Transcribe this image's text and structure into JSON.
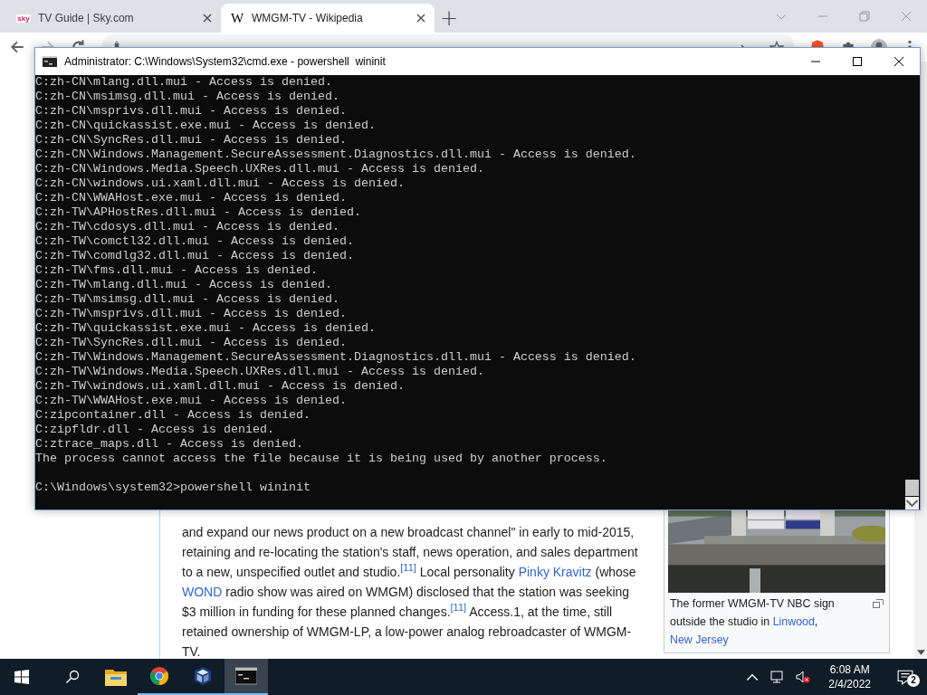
{
  "browser": {
    "tabs": [
      {
        "title": "TV Guide | Sky.com",
        "favicon": "sky",
        "kind": "sky",
        "selected": false
      },
      {
        "title": "WMGM-TV - Wikipedia",
        "favicon": "W",
        "kind": "wiki",
        "selected": true
      }
    ],
    "new_tab": "+"
  },
  "article": {
    "paragraph": [
      {
        "text": "and expand our news product on a new broadcast channel\" in early to mid-2015, retaining and re-locating the station's staff, news operation, and sales department to a new, unspecified outlet and studio.",
        "kind": "text"
      },
      {
        "text": "[11]",
        "kind": "ref"
      },
      {
        "text": " Local personality ",
        "kind": "text"
      },
      {
        "text": "Pinky Kravitz",
        "kind": "link"
      },
      {
        "text": " (whose ",
        "kind": "text"
      },
      {
        "text": "WOND",
        "kind": "link"
      },
      {
        "text": " radio show was aired on WMGM) disclosed that the station was seeking $3 million in funding for these planned changes.",
        "kind": "text"
      },
      {
        "text": "[11]",
        "kind": "ref"
      },
      {
        "text": " Access.1, at the time, still retained ownership of WMGM-LP, a low-power analog rebroadcaster of WMGM-TV.",
        "kind": "text"
      }
    ],
    "figure": {
      "caption": [
        {
          "text": "The former WMGM-TV NBC sign outside the studio in ",
          "kind": "text"
        },
        {
          "text": "Linwood",
          "kind": "link"
        },
        {
          "text": ", ",
          "kind": "text"
        },
        {
          "text": "New Jersey",
          "kind": "link"
        }
      ]
    }
  },
  "console_window": {
    "title": "Administrator: C:\\Windows\\System32\\cmd.exe - powershell  wininit",
    "lines": [
      "C:zh-CN\\mlang.dll.mui - Access is denied.",
      "C:zh-CN\\msimsg.dll.mui - Access is denied.",
      "C:zh-CN\\msprivs.dll.mui - Access is denied.",
      "C:zh-CN\\quickassist.exe.mui - Access is denied.",
      "C:zh-CN\\SyncRes.dll.mui - Access is denied.",
      "C:zh-CN\\Windows.Management.SecureAssessment.Diagnostics.dll.mui - Access is denied.",
      "C:zh-CN\\Windows.Media.Speech.UXRes.dll.mui - Access is denied.",
      "C:zh-CN\\windows.ui.xaml.dll.mui - Access is denied.",
      "C:zh-CN\\WWAHost.exe.mui - Access is denied.",
      "C:zh-TW\\APHostRes.dll.mui - Access is denied.",
      "C:zh-TW\\cdosys.dll.mui - Access is denied.",
      "C:zh-TW\\comctl32.dll.mui - Access is denied.",
      "C:zh-TW\\comdlg32.dll.mui - Access is denied.",
      "C:zh-TW\\fms.dll.mui - Access is denied.",
      "C:zh-TW\\mlang.dll.mui - Access is denied.",
      "C:zh-TW\\msimsg.dll.mui - Access is denied.",
      "C:zh-TW\\msprivs.dll.mui - Access is denied.",
      "C:zh-TW\\quickassist.exe.mui - Access is denied.",
      "C:zh-TW\\SyncRes.dll.mui - Access is denied.",
      "C:zh-TW\\Windows.Management.SecureAssessment.Diagnostics.dll.mui - Access is denied.",
      "C:zh-TW\\Windows.Media.Speech.UXRes.dll.mui - Access is denied.",
      "C:zh-TW\\windows.ui.xaml.dll.mui - Access is denied.",
      "C:zh-TW\\WWAHost.exe.mui - Access is denied.",
      "C:zipcontainer.dll - Access is denied.",
      "C:zipfldr.dll - Access is denied.",
      "C:ztrace_maps.dll - Access is denied.",
      "The process cannot access the file because it is being used by another process."
    ],
    "prompt": "C:\\Windows\\system32>powershell wininit"
  },
  "taskbar": {
    "apps": [
      {
        "kind": "explorer",
        "running": false,
        "selected": false
      },
      {
        "kind": "chrome",
        "running": true,
        "selected": false
      },
      {
        "kind": "virtualbox",
        "running": true,
        "selected": false
      },
      {
        "kind": "terminal",
        "running": true,
        "selected": true
      }
    ],
    "clock": {
      "time": "6:08 AM",
      "date": "2/4/2022"
    },
    "notifications": {
      "count": "2"
    }
  }
}
